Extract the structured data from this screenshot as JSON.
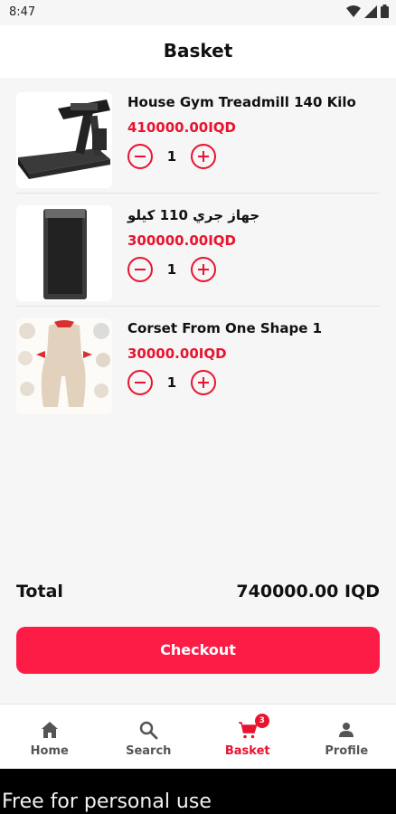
{
  "status_bar": {
    "time": "8:47"
  },
  "header": {
    "title": "Basket"
  },
  "cart": {
    "items": [
      {
        "name": "House Gym Treadmill 140 Kilo",
        "price": "410000.00IQD",
        "quantity": "1",
        "image": "treadmill-image"
      },
      {
        "name": "جهاز جري 110 كيلو",
        "price": "300000.00IQD",
        "quantity": "1",
        "image": "treadmill-topview-image"
      },
      {
        "name": "Corset From One Shape 1",
        "price": "30000.00IQD",
        "quantity": "1",
        "image": "corset-image"
      }
    ],
    "total_label": "Total",
    "total_value": "740000.00 IQD",
    "checkout_label": "Checkout"
  },
  "bottom_nav": {
    "items": [
      {
        "label": "Home",
        "icon": "home-icon"
      },
      {
        "label": "Search",
        "icon": "search-icon"
      },
      {
        "label": "Basket",
        "icon": "cart-icon",
        "badge": "3",
        "active": true
      },
      {
        "label": "Profile",
        "icon": "person-icon"
      }
    ]
  },
  "watermark": "Free for personal use",
  "colors": {
    "accent": "#e8142f",
    "button": "#fd1c46",
    "background": "#f6f6f6"
  }
}
